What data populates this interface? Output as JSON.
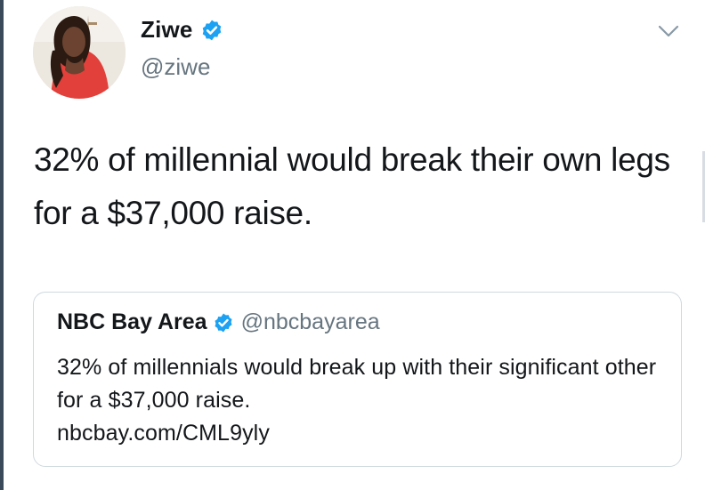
{
  "author": {
    "display_name": "Ziwe",
    "handle": "@ziwe",
    "verified": true,
    "avatar_icon": "profile-photo"
  },
  "tweet": {
    "text": "32% of millennial would break their own legs for a $37,000 raise."
  },
  "quoted_tweet": {
    "display_name": "NBC Bay Area",
    "handle": "@nbcbayarea",
    "verified": true,
    "text": "32% of millennials would break up with their significant other for a $37,000 raise.",
    "link": "nbcbay.com/CML9yly"
  },
  "icons": {
    "verified": "verified-badge-icon",
    "menu": "chevron-down-icon"
  },
  "colors": {
    "verified_blue": "#1da1f2",
    "secondary_text": "#66757f",
    "border": "#cfd9de"
  }
}
